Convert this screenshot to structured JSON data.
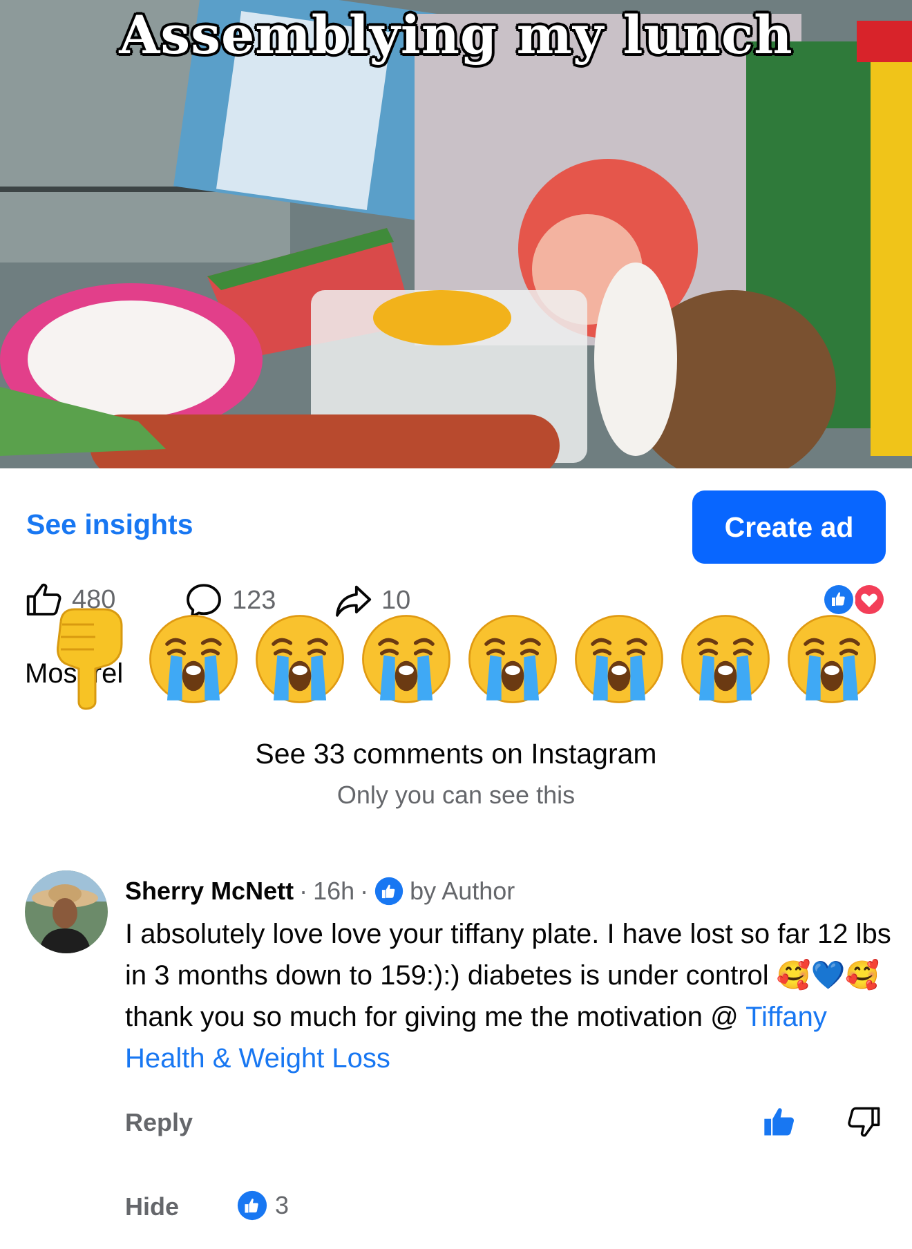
{
  "video": {
    "overlay_title": "Assemblying my lunch"
  },
  "actions": {
    "insights_label": "See insights",
    "create_ad_label": "Create ad"
  },
  "stats": {
    "likes": "480",
    "comments": "123",
    "shares": "10"
  },
  "sort": {
    "label": "Most rel"
  },
  "instagram": {
    "see_comments": "See 33 comments on Instagram",
    "visibility_note": "Only you can see this"
  },
  "comment": {
    "author": "Sherry McNett",
    "separator1": "·",
    "time": "16h",
    "separator2": "·",
    "badge": "by Author",
    "text_part1": "I absolutely love love your tiffany plate. I have lost so far 12 lbs in 3 months down to 159:):) diabetes is under control ",
    "emoji_text": "🥰💙🥰",
    "text_part2": " thank you so much for giving me the motivation @ ",
    "mention": "Tiffany Health & Weight Loss",
    "reply_label": "Reply",
    "hide_label": "Hide",
    "like_count": "3"
  },
  "icons": {
    "like": "thumbs-up-outline-icon",
    "comment": "speech-bubble-icon",
    "share": "share-arrow-icon",
    "reaction_like": "like-reaction-icon",
    "reaction_love": "love-reaction-icon",
    "crying": "loudly-crying-face-emoji",
    "pointing": "pointing-down-hand-emoji"
  },
  "colors": {
    "accent": "#1877f2",
    "button": "#0866ff",
    "secondary_text": "#65676b",
    "love": "#f33e58"
  }
}
